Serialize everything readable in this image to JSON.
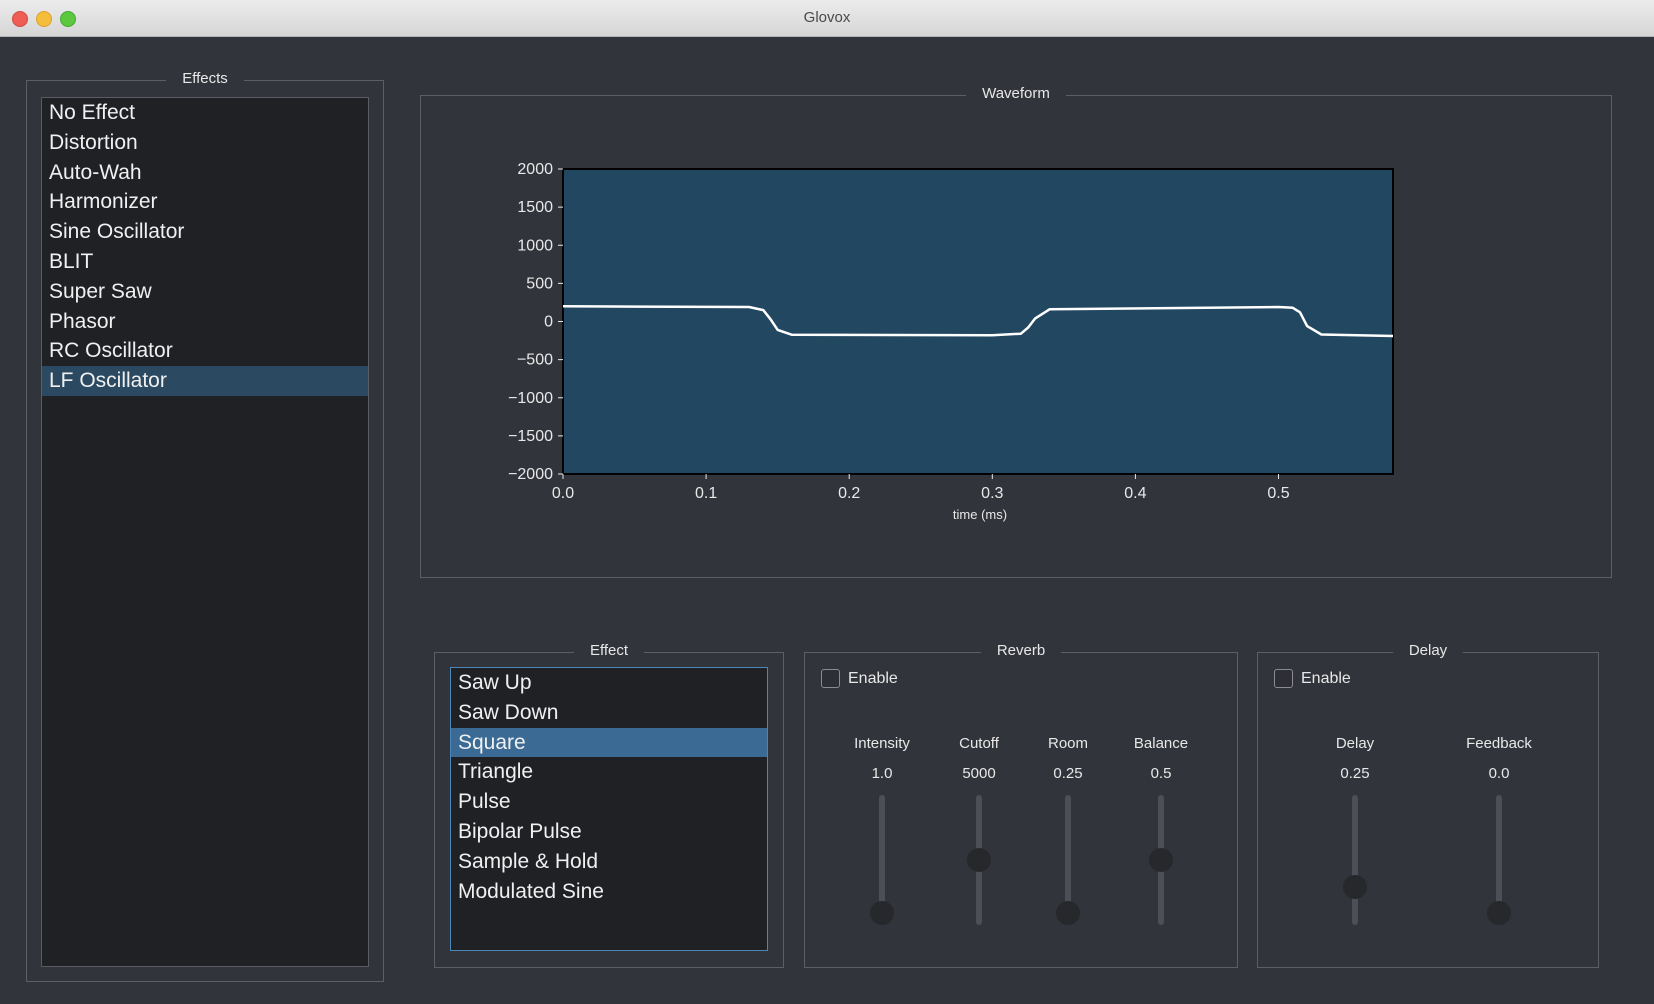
{
  "window": {
    "title": "Glovox"
  },
  "effects_panel": {
    "title": "Effects",
    "items": [
      "No Effect",
      "Distortion",
      "Auto-Wah",
      "Harmonizer",
      "Sine Oscillator",
      "BLIT",
      "Super Saw",
      "Phasor",
      "RC Oscillator",
      "LF Oscillator"
    ],
    "selected": "LF Oscillator"
  },
  "waveform_panel": {
    "title": "Waveform"
  },
  "chart_data": {
    "type": "line",
    "xlabel": "time (ms)",
    "ylabel": "",
    "xlim": [
      0.0,
      0.58
    ],
    "ylim": [
      -2000,
      2000
    ],
    "xticks": [
      "0.0",
      "0.1",
      "0.2",
      "0.3",
      "0.4",
      "0.5"
    ],
    "yticks": [
      "2000",
      "1500",
      "1000",
      "500",
      "0",
      "−500",
      "−1000",
      "−1500",
      "−2000"
    ],
    "grid": false,
    "series": [
      {
        "x": [
          0.0,
          0.13,
          0.14,
          0.145,
          0.15,
          0.16,
          0.3,
          0.32,
          0.325,
          0.33,
          0.34,
          0.5,
          0.51,
          0.515,
          0.52,
          0.53,
          0.58
        ],
        "y": [
          200,
          190,
          150,
          30,
          -110,
          -175,
          -180,
          -160,
          -80,
          40,
          160,
          190,
          180,
          120,
          -60,
          -170,
          -190
        ]
      }
    ],
    "colors": {
      "background": "#224760",
      "line": "#ffffff"
    }
  },
  "effect_panel": {
    "title": "Effect",
    "items": [
      "Saw Up",
      "Saw Down",
      "Square",
      "Triangle",
      "Pulse",
      "Bipolar Pulse",
      "Sample & Hold",
      "Modulated Sine"
    ],
    "selected": "Square"
  },
  "reverb_panel": {
    "title": "Reverb",
    "enable_label": "Enable",
    "enabled": false,
    "params": [
      {
        "label": "Intensity",
        "value": "1.0",
        "level": 0.0
      },
      {
        "label": "Cutoff",
        "value": "5000",
        "level": 0.5
      },
      {
        "label": "Room",
        "value": "0.25",
        "level": 0.0
      },
      {
        "label": "Balance",
        "value": "0.5",
        "level": 0.5
      }
    ]
  },
  "delay_panel": {
    "title": "Delay",
    "enable_label": "Enable",
    "enabled": false,
    "params": [
      {
        "label": "Delay",
        "value": "0.25",
        "level": 0.25
      },
      {
        "label": "Feedback",
        "value": "0.0",
        "level": 0.0
      }
    ]
  }
}
